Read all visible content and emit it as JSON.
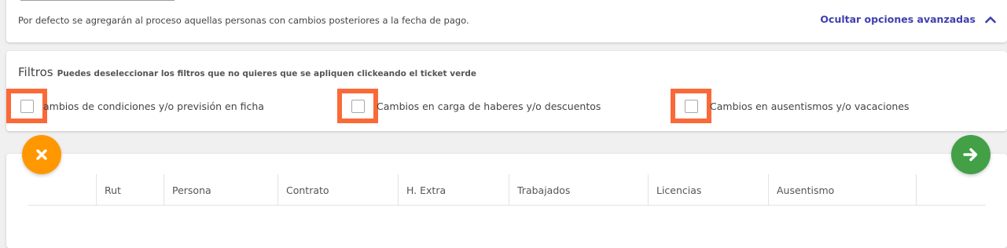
{
  "advanced": {
    "default_note": "Por defecto se agregarán al proceso aquellas personas con cambios posteriores a la fecha de pago.",
    "toggle_label": "Ocultar opciones avanzadas",
    "toggle_icon": "chevron-up-icon",
    "accent_color": "#3f3fb0"
  },
  "filters": {
    "title": "Filtros",
    "hint": "Puedes deseleccionar los filtros que no quieres que se apliquen clickeando el ticket verde",
    "highlight_color": "#fa6a38",
    "items": [
      {
        "label": "ambios de condiciones y/o previsión en ficha",
        "checked": false
      },
      {
        "label": "Cambios en carga de haberes y/o descuentos",
        "checked": false
      },
      {
        "label": "Cambios en ausentismos y/o vacaciones",
        "checked": false
      }
    ]
  },
  "actions": {
    "cancel_icon": "close-icon",
    "cancel_color": "#ff9800",
    "next_icon": "arrow-right-icon",
    "next_color": "#43a047"
  },
  "table": {
    "columns": [
      "",
      "Rut",
      "Persona",
      "Contrato",
      "H. Extra",
      "Trabajados",
      "Licencias",
      "Ausentismo",
      ""
    ]
  }
}
